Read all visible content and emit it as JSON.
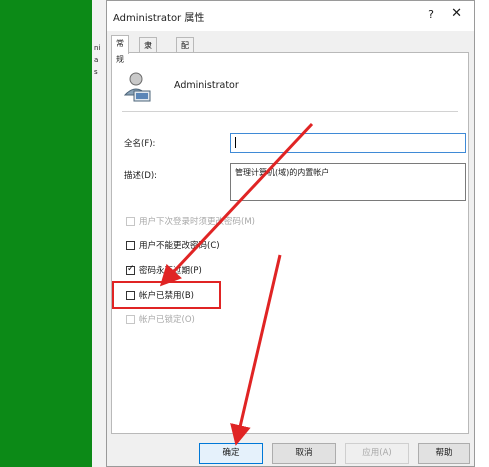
{
  "background": {
    "fragments": [
      "ni",
      "a",
      "s"
    ]
  },
  "dialog": {
    "title": "Administrator 属性",
    "help_glyph": "?",
    "close_glyph": "✕",
    "tabs": [
      {
        "label": "常规",
        "active": true
      },
      {
        "label": "隶属于",
        "active": false
      },
      {
        "label": "配置文件",
        "active": false
      }
    ],
    "user": {
      "name": "Administrator"
    },
    "full_name": {
      "label": "全名(F):",
      "value": ""
    },
    "description": {
      "label": "描述(D):",
      "value": "管理计算机(域)的内置帐户"
    },
    "checkboxes": [
      {
        "label": "用户下次登录时须更改密码(M)",
        "checked": false,
        "enabled": false
      },
      {
        "label": "用户不能更改密码(C)",
        "checked": false,
        "enabled": true
      },
      {
        "label": "密码永不过期(P)",
        "checked": true,
        "enabled": true
      },
      {
        "label": "帐户已禁用(B)",
        "checked": false,
        "enabled": true
      },
      {
        "label": "帐户已锁定(O)",
        "checked": false,
        "enabled": false
      }
    ],
    "buttons": {
      "ok": "确定",
      "cancel": "取消",
      "apply": "应用(A)",
      "help": "帮助"
    }
  },
  "colors": {
    "background_green": "#0c8a17",
    "annotation_red": "#e02424",
    "focus_blue": "#3f8ad6"
  }
}
